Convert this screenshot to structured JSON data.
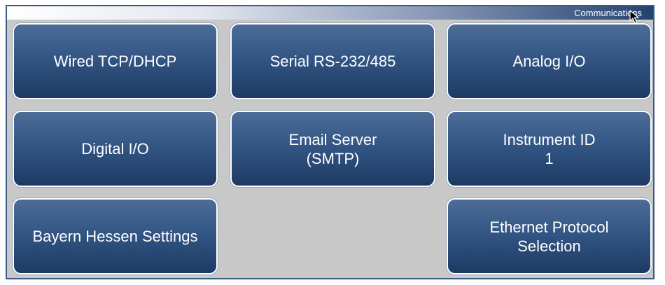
{
  "header": {
    "title": "Communications"
  },
  "tiles": [
    {
      "line1": "Wired TCP/DHCP",
      "line2": ""
    },
    {
      "line1": "Serial RS-232/485",
      "line2": ""
    },
    {
      "line1": "Analog I/O",
      "line2": ""
    },
    {
      "line1": "Digital I/O",
      "line2": ""
    },
    {
      "line1": "Email Server",
      "line2": "(SMTP)"
    },
    {
      "line1": "Instrument ID",
      "line2": "1"
    },
    {
      "line1": "Bayern Hessen Settings",
      "line2": ""
    },
    {
      "line1": "Ethernet Protocol",
      "line2": "Selection"
    }
  ]
}
